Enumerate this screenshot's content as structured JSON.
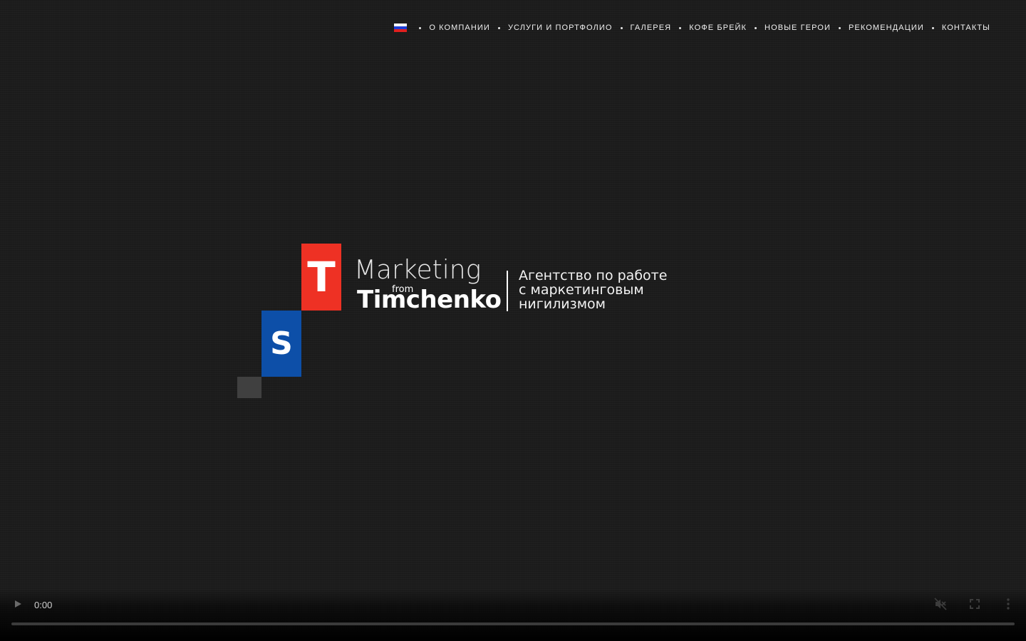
{
  "nav": {
    "flag_colors": [
      "#ffffff",
      "#1c3dd6",
      "#e02020"
    ],
    "items": [
      {
        "label": "О КОМПАНИИ"
      },
      {
        "label": "УСЛУГИ И ПОРТФОЛИО"
      },
      {
        "label": "ГАЛЕРЕЯ"
      },
      {
        "label": "КОФЕ БРЕЙК"
      },
      {
        "label": "НОВЫЕ ГЕРОИ"
      },
      {
        "label": "РЕКОМЕНДАЦИИ"
      },
      {
        "label": "КОНТАКТЫ"
      }
    ]
  },
  "logo": {
    "block_t": {
      "letter": "T",
      "color": "#ee3124"
    },
    "block_s": {
      "letter": "S",
      "color": "#0d4fa8"
    },
    "block_small_color": "#404040",
    "marketing": "Marketing",
    "from": "from",
    "name": "Timchenko",
    "tagline": [
      "Агентство по работе",
      "с маркетинговым",
      "нигилизмом"
    ]
  },
  "video": {
    "current_time": "0:00",
    "progress": 0,
    "play_icon": "play-icon",
    "mute_icon": "muted-speaker-icon",
    "fullscreen_icon": "fullscreen-icon",
    "more_icon": "more-vertical-icon"
  }
}
